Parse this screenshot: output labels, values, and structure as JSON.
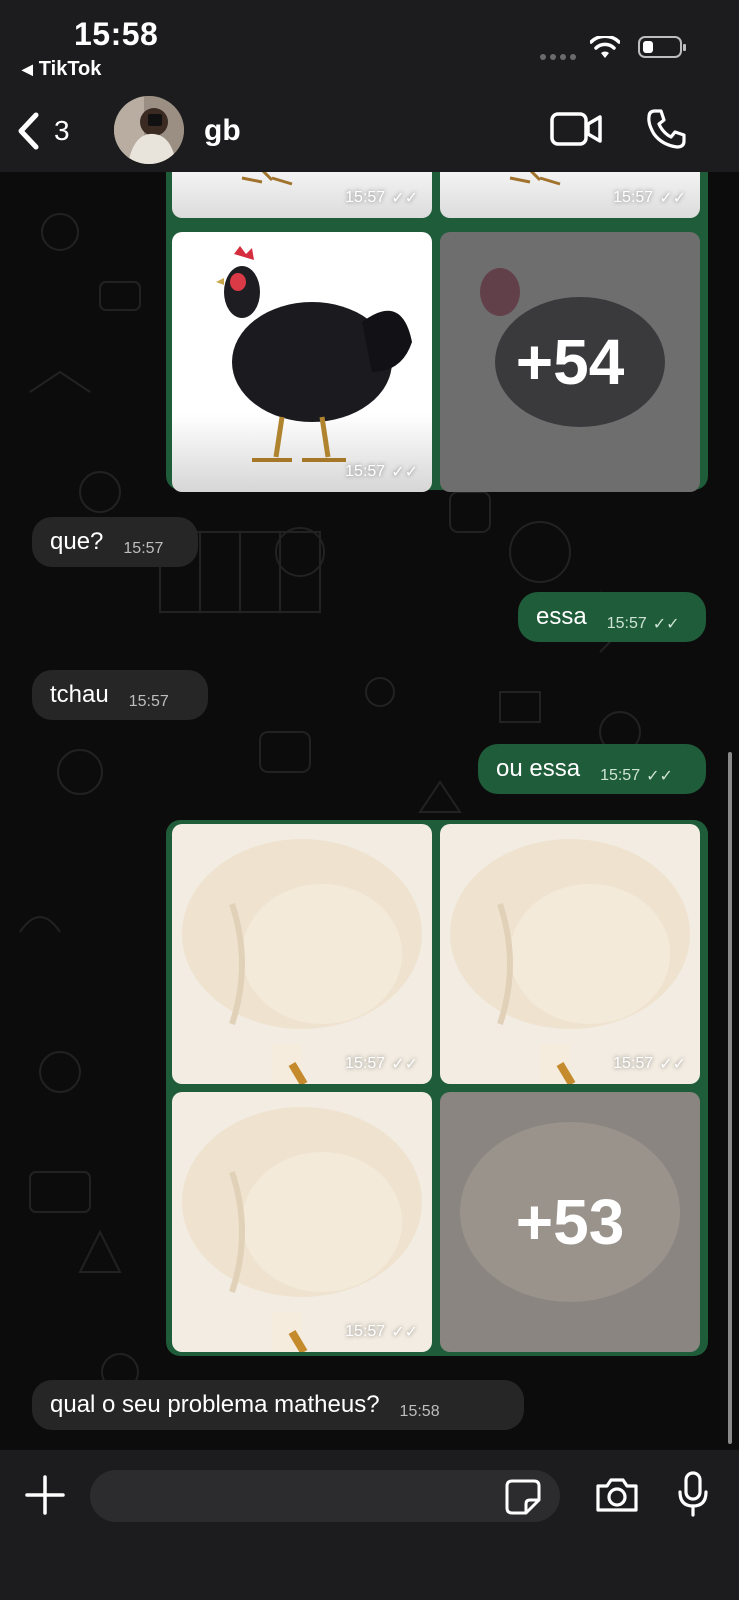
{
  "status_bar": {
    "time": "15:58",
    "back_app": "TikTok"
  },
  "header": {
    "back_count": "3",
    "contact_name": "gb"
  },
  "messages": [
    {
      "time": "15:57"
    },
    {
      "time": "15:57"
    },
    {
      "time": "15:57"
    },
    {
      "more": "+54"
    },
    {
      "text": "que?",
      "time": "15:57"
    },
    {
      "text": "essa",
      "time": "15:57"
    },
    {
      "text": "tchau",
      "time": "15:57"
    },
    {
      "text": "ou essa",
      "time": "15:57"
    },
    {
      "time": "15:57"
    },
    {
      "time": "15:57"
    },
    {
      "time": "15:57"
    },
    {
      "more": "+53"
    },
    {
      "text": "qual o seu problema matheus?",
      "time": "15:58"
    }
  ],
  "colors": {
    "outgoing_bubble": "#1f5c3a",
    "incoming_bubble": "#262626",
    "bars": "#1c1c1e"
  }
}
